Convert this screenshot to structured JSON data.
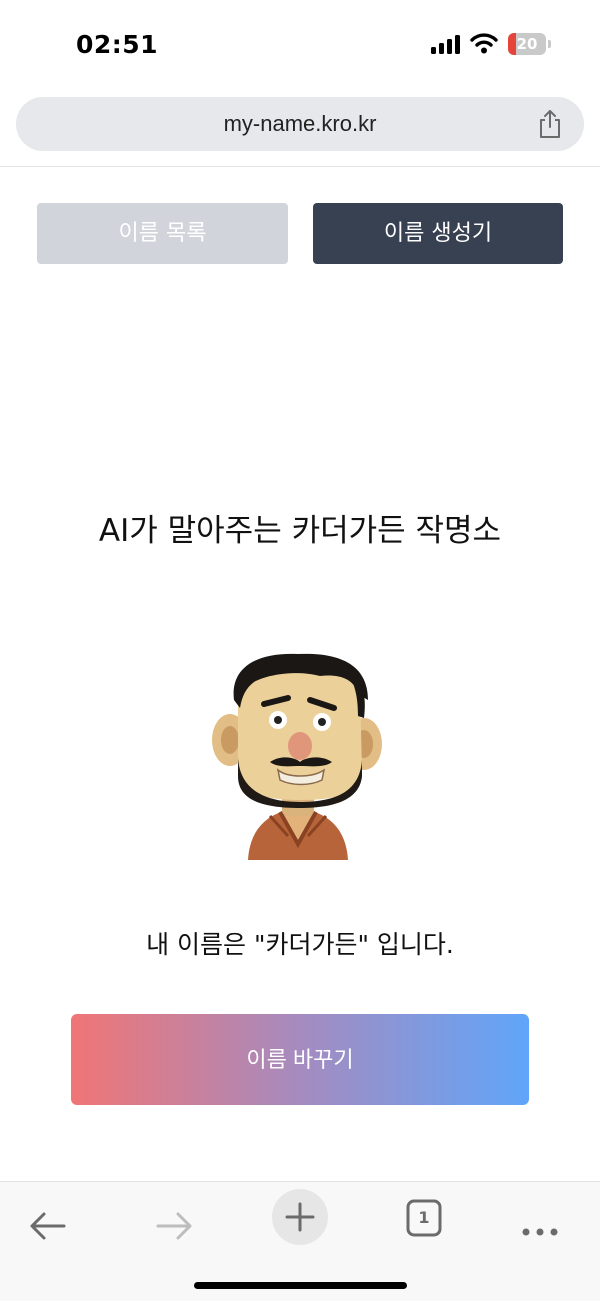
{
  "status_bar": {
    "time": "02:51",
    "battery_level": "20"
  },
  "browser": {
    "url": "my-name.kro.kr",
    "tab_count": "1"
  },
  "tabs": [
    {
      "label": "이름 목록",
      "active": false
    },
    {
      "label": "이름 생성기",
      "active": true
    }
  ],
  "main": {
    "headline": "AI가 말아주는 카더가든 작명소",
    "intro": "내 이름은 \"카더가든\" 입니다.",
    "change_name_button": "이름 바꾸기"
  },
  "colors": {
    "tab_inactive": "#d1d5db",
    "tab_active": "#374151",
    "gradient_start": "#f07575",
    "gradient_end": "#60a5fa"
  },
  "icons": [
    "signal-icon",
    "wifi-icon",
    "battery-icon",
    "share-icon",
    "back-arrow-icon",
    "forward-arrow-icon",
    "plus-icon",
    "tabs-icon",
    "more-icon"
  ]
}
